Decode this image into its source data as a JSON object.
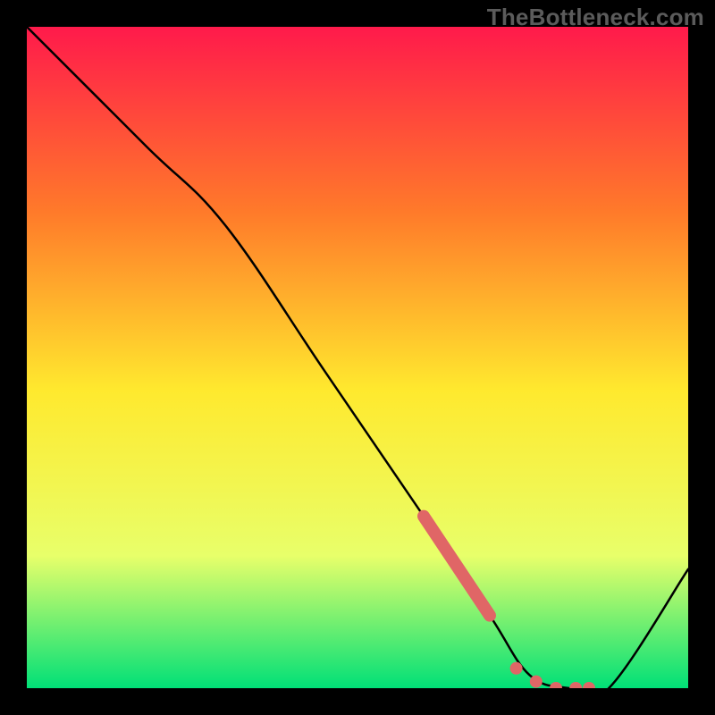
{
  "watermark": "TheBottleneck.com",
  "colors": {
    "gradient_top": "#ff1a4b",
    "gradient_mid_upper": "#ff7a2a",
    "gradient_mid": "#ffe92e",
    "gradient_lower": "#e8ff6a",
    "gradient_bottom": "#00e077",
    "curve": "#000000",
    "dotted": "#e06666",
    "frame": "#000000"
  },
  "chart_data": {
    "type": "line",
    "title": "",
    "xlabel": "",
    "ylabel": "",
    "xlim": [
      0,
      100
    ],
    "ylim": [
      0,
      100
    ],
    "grid": false,
    "legend": false,
    "series": [
      {
        "name": "bottleneck-curve",
        "x": [
          0,
          18,
          30,
          45,
          60,
          70,
          76,
          82,
          88,
          100
        ],
        "y": [
          100,
          82,
          70,
          48,
          26,
          11,
          2,
          0,
          0,
          18
        ]
      },
      {
        "name": "highlighted-segment-thick",
        "style": "thick",
        "x": [
          60,
          70
        ],
        "y": [
          26,
          11
        ]
      },
      {
        "name": "highlighted-dots",
        "style": "dots",
        "x": [
          74,
          77,
          80,
          83,
          85
        ],
        "y": [
          3,
          1,
          0,
          0,
          0
        ]
      }
    ]
  }
}
